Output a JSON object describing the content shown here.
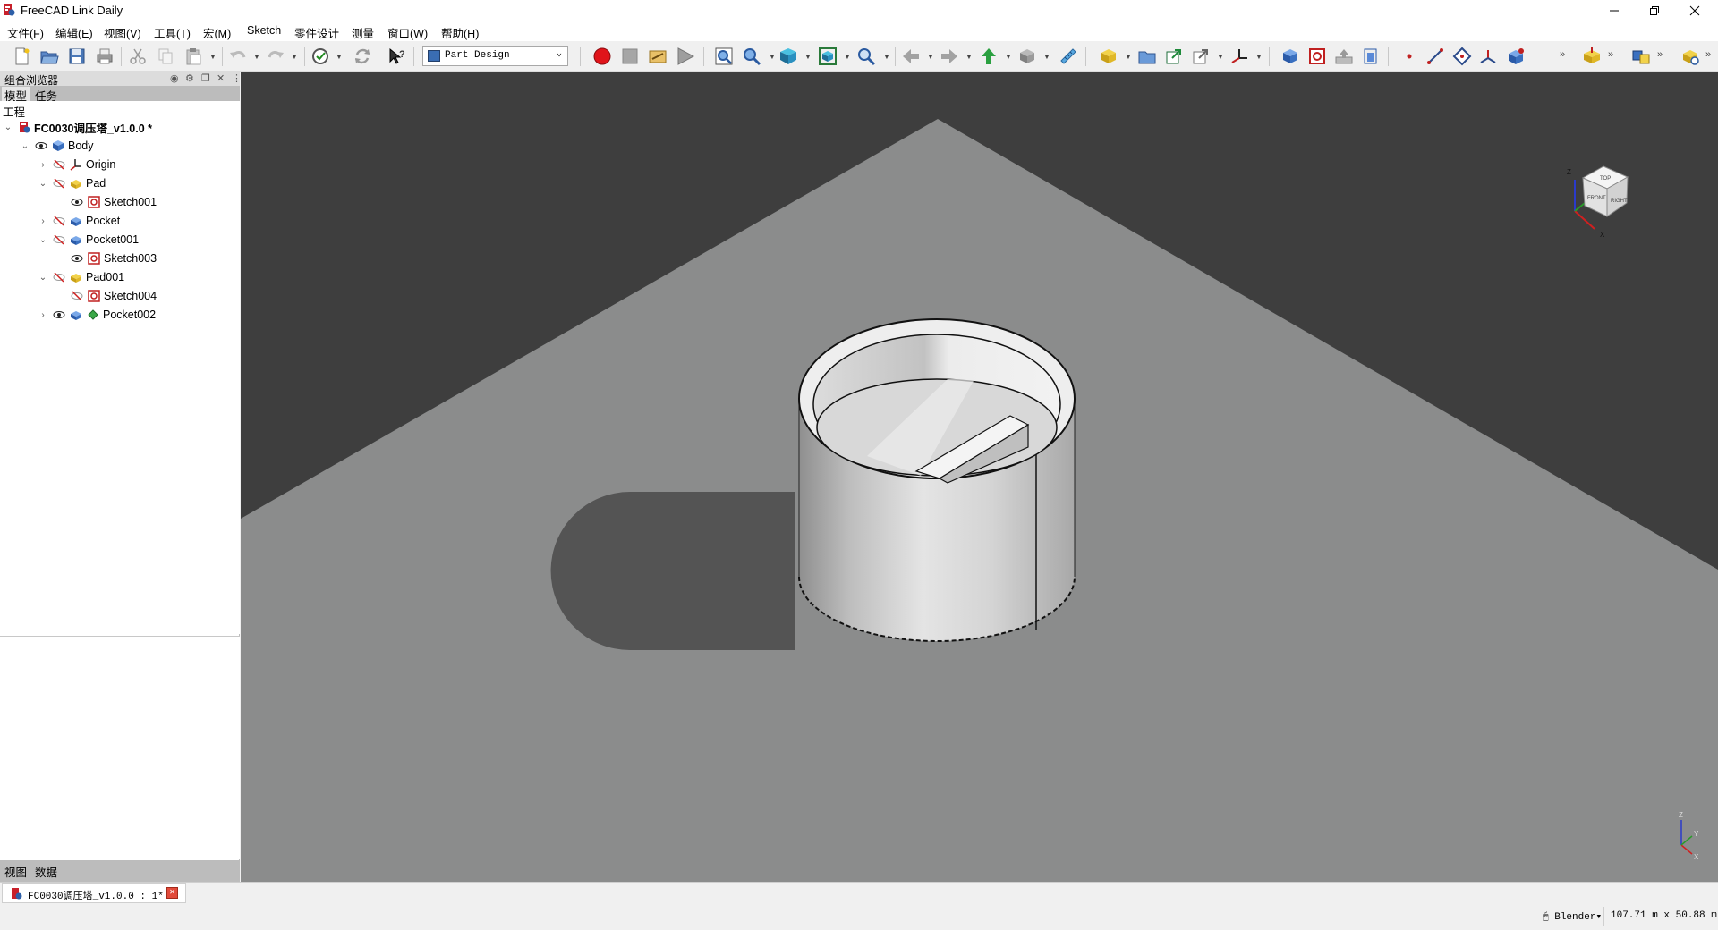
{
  "window": {
    "title": "FreeCAD Link Daily"
  },
  "menu": [
    "文件(F)",
    "编辑(E)",
    "视图(V)",
    "工具(T)",
    "宏(M)",
    "Sketch",
    "零件设计",
    "测量",
    "窗口(W)",
    "帮助(H)"
  ],
  "toolbar": {
    "workbench": "Part Design",
    "overflow": "»"
  },
  "left_panel": {
    "title": "组合浏览器",
    "top_tabs": [
      "模型",
      "任务"
    ],
    "tree_header": "工程",
    "tree": [
      {
        "label": "FC0030调压塔_v1.0.0 *",
        "expanded": true
      },
      {
        "label": "Body",
        "expanded": true
      },
      {
        "label": "Origin",
        "expanded": false
      },
      {
        "label": "Pad",
        "expanded": true
      },
      {
        "label": "Sketch001"
      },
      {
        "label": "Pocket",
        "expanded": false
      },
      {
        "label": "Pocket001",
        "expanded": true
      },
      {
        "label": "Sketch003"
      },
      {
        "label": "Pad001",
        "expanded": true
      },
      {
        "label": "Sketch004"
      },
      {
        "label": "Pocket002",
        "expanded": false
      }
    ],
    "bottom_tabs": [
      "视图",
      "数据"
    ]
  },
  "navcube": {
    "z": "Z",
    "x": "X",
    "top": "TOP",
    "front": "FRONT",
    "right": "RIGHT"
  },
  "axis_indicator": {
    "z": "Z",
    "y": "Y",
    "x": "X"
  },
  "doc_tab": {
    "label": "FC0030调压塔_v1.0.0 : 1*"
  },
  "status": {
    "navigation": "Blender",
    "dimensions": "107.71 m x 50.88 m"
  },
  "colors": {
    "viewport_bg": "#3e3e3e",
    "ground": "#8b8c8c",
    "shadow": "#545454",
    "record": "#e0141a"
  }
}
